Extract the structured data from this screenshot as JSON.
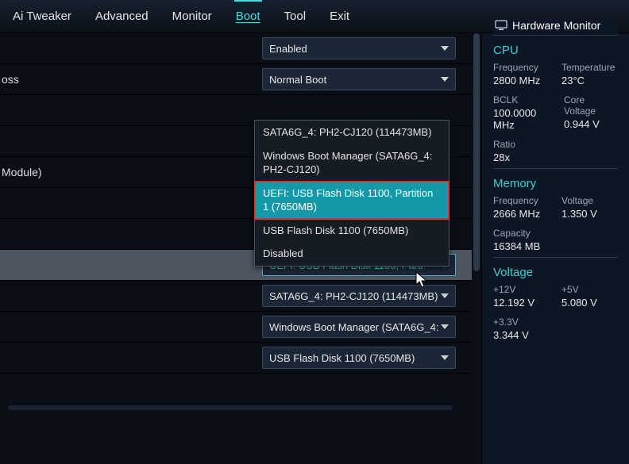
{
  "tabs": [
    "Ai Tweaker",
    "Advanced",
    "Monitor",
    "Boot",
    "Tool",
    "Exit"
  ],
  "active_tab": "Boot",
  "hw": {
    "header": "Hardware Monitor",
    "cpu": {
      "title": "CPU",
      "freq_lbl": "Frequency",
      "freq_val": "2800 MHz",
      "temp_lbl": "Temperature",
      "temp_val": "23°C",
      "bclk_lbl": "BCLK",
      "bclk_val": "100.0000 MHz",
      "core_lbl": "Core Voltage",
      "core_val": "0.944 V",
      "ratio_lbl": "Ratio",
      "ratio_val": "28x"
    },
    "mem": {
      "title": "Memory",
      "freq_lbl": "Frequency",
      "freq_val": "2666 MHz",
      "volt_lbl": "Voltage",
      "volt_val": "1.350 V",
      "cap_lbl": "Capacity",
      "cap_val": "16384 MB"
    },
    "volt": {
      "title": "Voltage",
      "v12_lbl": "+12V",
      "v12_val": "12.192 V",
      "v5_lbl": "+5V",
      "v5_val": "5.080 V",
      "v33_lbl": "+3.3V",
      "v33_val": "3.344 V"
    }
  },
  "rows": {
    "r0_label": "",
    "r0_value": "Enabled",
    "r1_label": "oss",
    "r1_value": "Normal Boot",
    "r2_label": "",
    "r3_label": "",
    "r4_label": "Module)",
    "r5_label": "",
    "r5_value": "",
    "r6_label": "",
    "r7_value": "UEFI: USB Flash Disk 1100, Parti",
    "r8_value": "SATA6G_4: PH2-CJ120 (114473MB)",
    "r9_value": "Windows Boot Manager (SATA6G_4:",
    "r10_value": "USB Flash Disk 1100  (7650MB)"
  },
  "dropdown": [
    "SATA6G_4: PH2-CJ120 (114473MB)",
    "Windows Boot Manager (SATA6G_4: PH2-CJ120)",
    "UEFI: USB Flash Disk 1100, Partition 1 (7650MB)",
    "USB Flash Disk 1100  (7650MB)",
    "Disabled"
  ],
  "dropdown_selected": 2
}
